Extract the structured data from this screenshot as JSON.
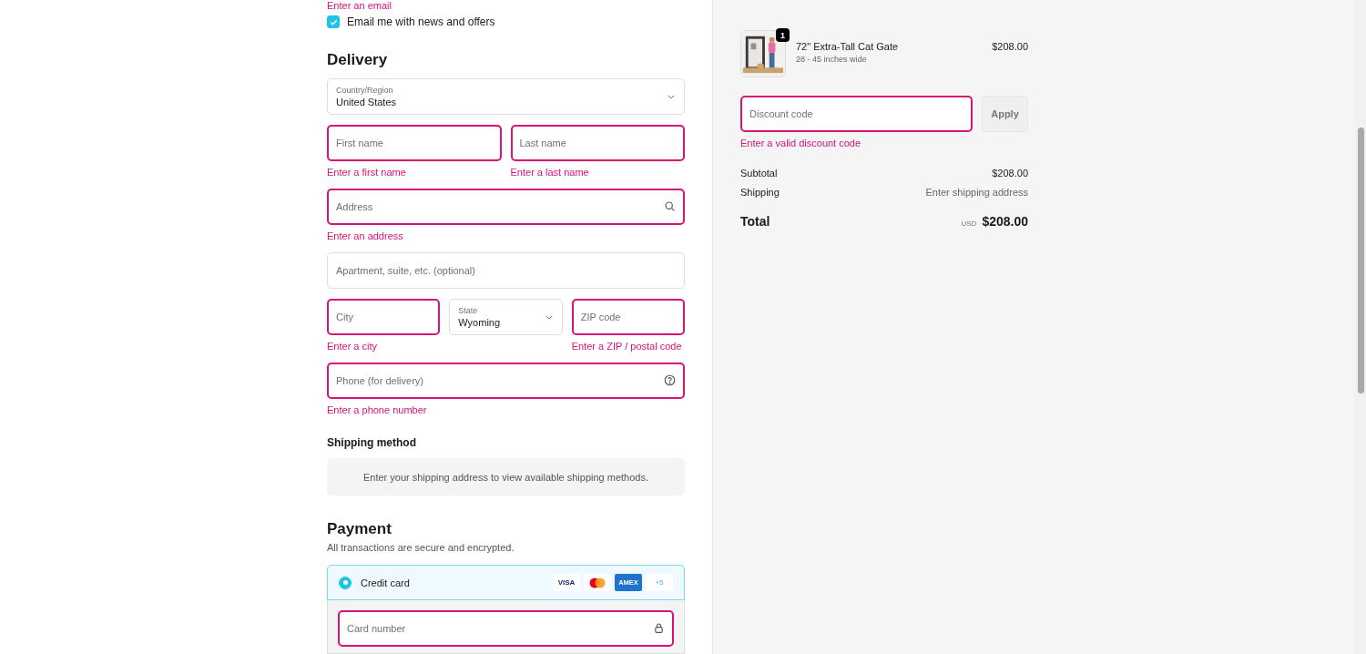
{
  "contact": {
    "error": "Enter an email",
    "newsletter": {
      "label": "Email me with news and offers",
      "checked": true
    }
  },
  "delivery": {
    "title": "Delivery",
    "rows": [
      [
        {
          "kind": "select",
          "label": "Country/Region",
          "value": "United States"
        }
      ],
      [
        {
          "kind": "text",
          "placeholder": "First name",
          "invalid": true,
          "error": "Enter a first name"
        },
        {
          "kind": "text",
          "placeholder": "Last name",
          "invalid": true,
          "error": "Enter a last name"
        }
      ],
      [
        {
          "placeholder": "Address",
          "invalid": true,
          "error": "Enter an address",
          "kind": "search"
        }
      ],
      [
        {
          "kind": "text",
          "placeholder": "Apartment, suite, etc. (optional)",
          "invalid": false
        }
      ],
      [
        {
          "kind": "text",
          "placeholder": "City",
          "invalid": true,
          "error": "Enter a city"
        },
        {
          "kind": "select",
          "label": "State",
          "value": "Wyoming"
        },
        {
          "kind": "text",
          "placeholder": "ZIP code",
          "invalid": true,
          "error": "Enter a ZIP / postal code"
        }
      ],
      [
        {
          "kind": "phone",
          "placeholder": "Phone (for delivery)",
          "invalid": true,
          "error": "Enter a phone number"
        }
      ]
    ]
  },
  "shipping_method": {
    "title": "Shipping method",
    "notice": "Enter your shipping address to view available shipping methods."
  },
  "payment": {
    "title": "Payment",
    "subtitle": "All transactions are secure and encrypted.",
    "methods": [
      {
        "label": "Credit card",
        "selected": true,
        "cards": [
          {
            "kind": "visa",
            "label": "VISA"
          },
          {
            "kind": "mastercard"
          },
          {
            "kind": "amex",
            "label": "AMEX"
          },
          {
            "kind": "more",
            "label": "+5"
          }
        ]
      }
    ],
    "card_number": {
      "placeholder": "Card number",
      "invalid": true
    }
  },
  "summary": {
    "items": [
      {
        "quantity": "1",
        "name": "72\" Extra-Tall Cat Gate",
        "variant": "28 - 45 inches wide",
        "price": "$208.00"
      }
    ],
    "discount": {
      "placeholder": "Discount code",
      "invalid": true,
      "error": "Enter a valid discount code",
      "button": "Apply"
    },
    "lines": [
      {
        "label": "Subtotal",
        "value": "$208.00",
        "muted": false
      },
      {
        "label": "Shipping",
        "value": "Enter shipping address",
        "muted": true
      }
    ],
    "total": {
      "label": "Total",
      "currency": "USD",
      "value": "$208.00"
    }
  }
}
